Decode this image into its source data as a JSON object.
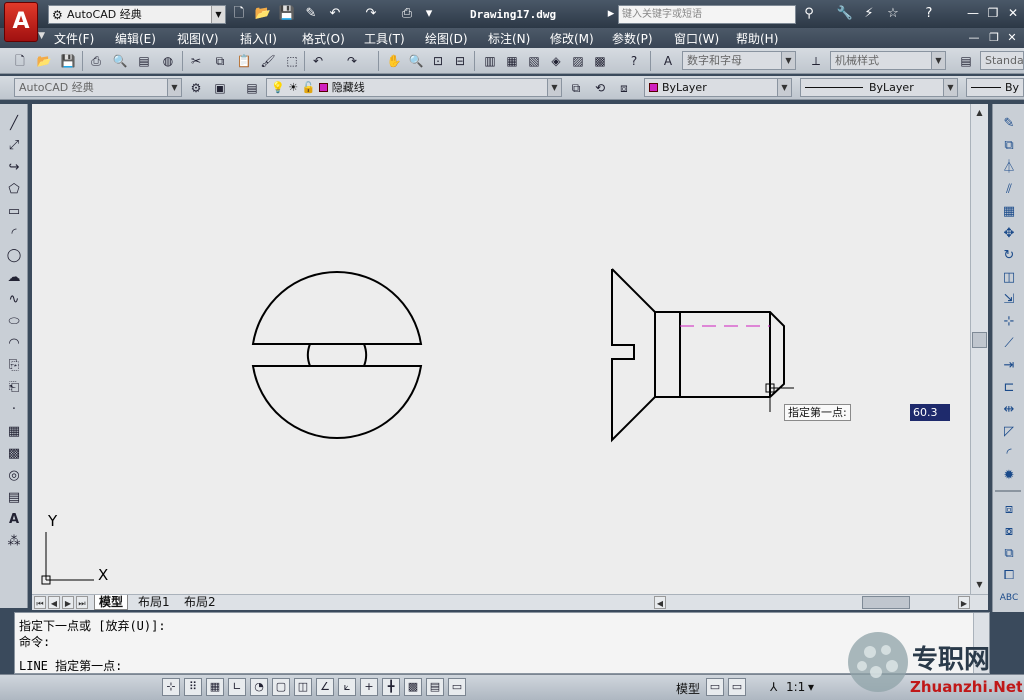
{
  "app": {
    "logo_letter": "A",
    "workspace": "AutoCAD 经典",
    "doc_title": "Drawing17.dwg",
    "search_placeholder": "键入关键字或短语"
  },
  "menu": [
    "文件(F)",
    "编辑(E)",
    "视图(V)",
    "插入(I)",
    "格式(O)",
    "工具(T)",
    "绘图(D)",
    "标注(N)",
    "修改(M)",
    "参数(P)",
    "窗口(W)",
    "帮助(H)"
  ],
  "toolbar1": {
    "text_style": "数字和字母",
    "dim_style": "机械样式",
    "table_style": "Standa"
  },
  "toolbar2": {
    "workspace": "AutoCAD 经典",
    "layer": "隐藏线",
    "color": "ByLayer",
    "linetype": "ByLayer",
    "lineweight": "By"
  },
  "tabs": [
    "模型",
    "布局1",
    "布局2"
  ],
  "ucs": {
    "y": "Y",
    "x": "X"
  },
  "dynamic_input": {
    "prompt": "指定第一点:",
    "value": "60.3"
  },
  "command_lines": [
    "指定下一点或 [放弃(U)]:",
    "命令:",
    "LINE 指定第一点:"
  ],
  "status": {
    "model": "模型",
    "scale": "1:1"
  },
  "watermark": {
    "title": "专职网",
    "url": "Zhuanzhi.Net"
  },
  "colors": {
    "canvas": "#ededed",
    "hidden_line": "#d020c0",
    "title_bg": "#2c3846"
  }
}
